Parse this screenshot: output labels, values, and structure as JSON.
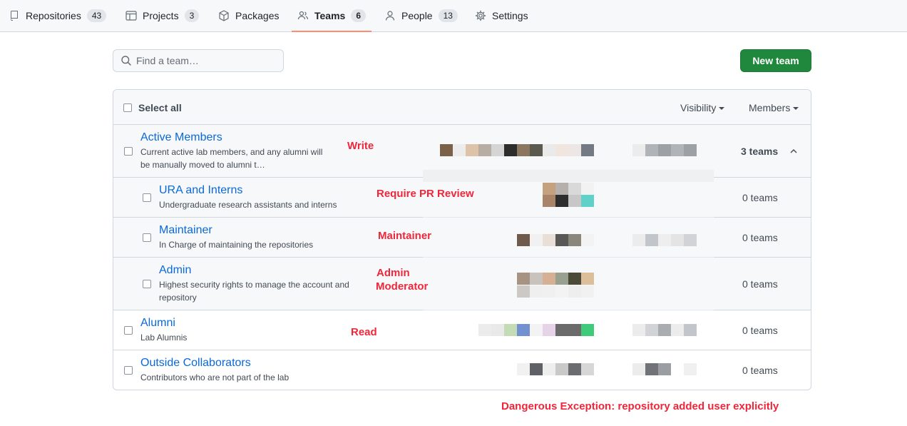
{
  "nav": {
    "items": [
      {
        "label": "Repositories",
        "count": "43",
        "icon": "repo-icon"
      },
      {
        "label": "Projects",
        "count": "3",
        "icon": "project-icon"
      },
      {
        "label": "Packages",
        "count": "",
        "icon": "package-icon"
      },
      {
        "label": "Teams",
        "count": "6",
        "icon": "people-icon"
      },
      {
        "label": "People",
        "count": "13",
        "icon": "person-icon"
      },
      {
        "label": "Settings",
        "count": "",
        "icon": "gear-icon"
      }
    ],
    "selected": "Teams"
  },
  "search": {
    "placeholder": "Find a team…"
  },
  "new_team_label": "New team",
  "table": {
    "select_all": "Select all",
    "visibility_label": "Visibility",
    "members_label": "Members",
    "teams": [
      {
        "name": "Active Members",
        "description": "Current active lab members, and any alumni will be manually moved to alumni t…",
        "count": "3 teams"
      },
      {
        "name": "URA and Interns",
        "description": "Undergraduate research assistants and interns",
        "count": "0 teams"
      },
      {
        "name": "Maintainer",
        "description": "In Charge of maintaining the repositories",
        "count": "0 teams"
      },
      {
        "name": "Admin",
        "description": "Highest security rights to manage the account and repository",
        "count": "0 teams"
      },
      {
        "name": "Alumni",
        "description": "Lab Alumnis",
        "count": "0 teams"
      },
      {
        "name": "Outside Collaborators",
        "description": "Contributors who are not part of the lab",
        "count": "0 teams"
      }
    ]
  },
  "annotations": {
    "write": "Write",
    "require_pr": "Require PR Review",
    "maintainer": "Maintainer",
    "admin": "Admin",
    "moderator": "Moderator",
    "read": "Read",
    "exception": "Dangerous Exception: repository added user explicitly"
  },
  "colors": {
    "accent": "#0969da",
    "primary_button": "#1f883d",
    "annotation": "#f0263a",
    "tab_underline": "#fd8c73"
  }
}
